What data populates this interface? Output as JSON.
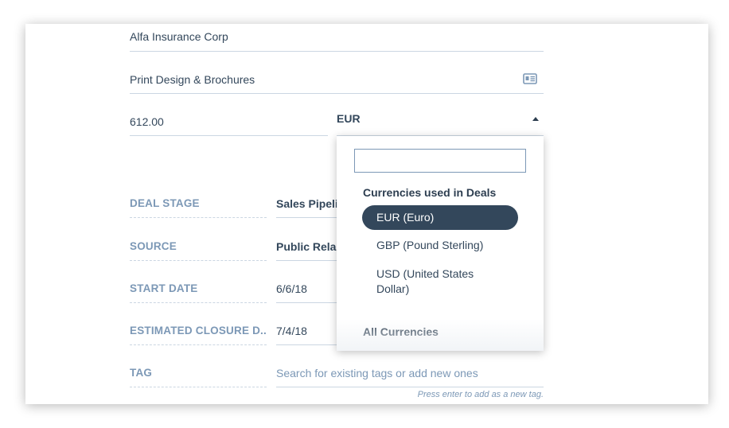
{
  "form": {
    "company": "Alfa Insurance Corp",
    "deal_name": "Print Design & Brochures",
    "amount": "612.00",
    "currency": "EUR",
    "card_icon": "contact-card-icon",
    "caret_icon": "caret-up-icon"
  },
  "properties": [
    {
      "label": "DEAL STAGE",
      "value": "Sales Pipeli"
    },
    {
      "label": "SOURCE",
      "value": "Public Rela"
    },
    {
      "label": "START DATE",
      "value": "6/6/18"
    },
    {
      "label": "ESTIMATED CLOSURE D...",
      "value": "7/4/18"
    },
    {
      "label": "TAG",
      "value": "Search for existing tags or add new ones"
    }
  ],
  "tag_hint": "Press enter to add as a new tag.",
  "currency_dropdown": {
    "search_placeholder": "",
    "group_used": "Currencies used in Deals",
    "options": [
      "EUR (Euro)",
      "GBP (Pound Sterling)",
      "USD (United States Dollar)"
    ],
    "selected": "EUR (Euro)",
    "group_all": "All Currencies"
  },
  "colors": {
    "selected_bg": "#33475b",
    "label_gray": "#7c98b6",
    "text_dark": "#33475b"
  }
}
